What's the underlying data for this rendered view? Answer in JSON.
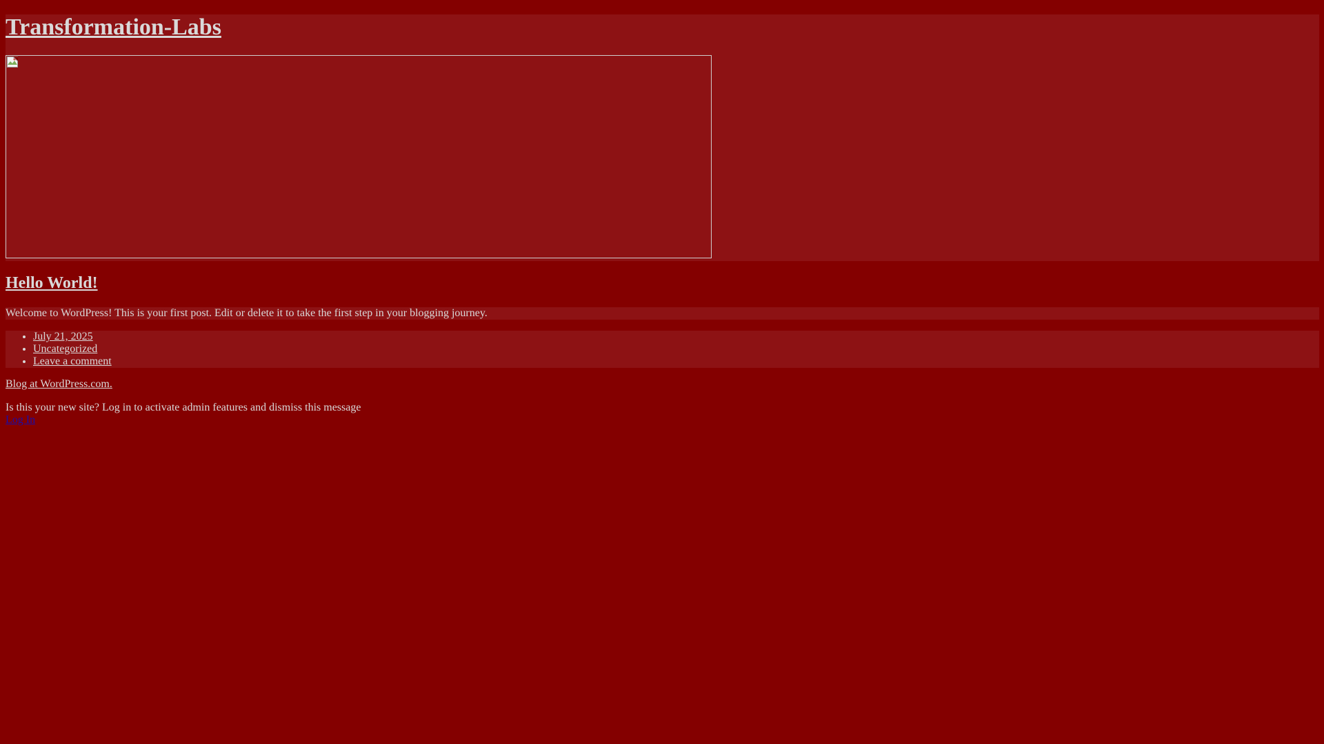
{
  "site": {
    "title": "Transformation-Labs"
  },
  "post": {
    "title": "Hello World!",
    "content": "Welcome to WordPress! This is your first post. Edit or delete it to take the first step in your blogging journey.",
    "meta": {
      "date": "July 21, 2025",
      "category": "Uncategorized",
      "comment_link": "Leave a comment"
    }
  },
  "footer": {
    "credit": "Blog at WordPress.com."
  },
  "admin_notice": {
    "message": "Is this your new site? Log in to activate admin features and dismiss this message",
    "login_label": "Log In"
  },
  "colors": {
    "background": "#840000",
    "panel": "#8d1214",
    "text": "#d9d9d9",
    "login_link": "#1a0dab"
  },
  "icons": {
    "header_image": "broken-image-icon"
  }
}
